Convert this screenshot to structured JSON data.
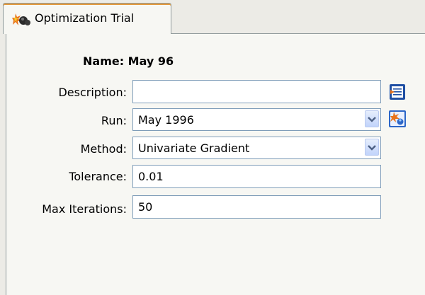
{
  "tab": {
    "label": "Optimization Trial",
    "icon": "optimization-trial-icon"
  },
  "form": {
    "name_label": "Name: May 96",
    "description": {
      "label": "Description:",
      "value": ""
    },
    "run": {
      "label": "Run:",
      "value": "May 1996"
    },
    "method": {
      "label": "Method:",
      "value": "Univariate Gradient"
    },
    "tolerance": {
      "label": "Tolerance:",
      "value": "0.01"
    },
    "max_iterations": {
      "label": "Max Iterations:",
      "value": "50"
    }
  },
  "icons": {
    "description_editor": "edit-description-icon",
    "run_manager": "run-manager-icon",
    "dropdown": "chevron-down-icon"
  },
  "colors": {
    "tab_highlight": "#e59a3c",
    "field_border": "#7f9db9",
    "panel_background": "#f7f7f3"
  }
}
